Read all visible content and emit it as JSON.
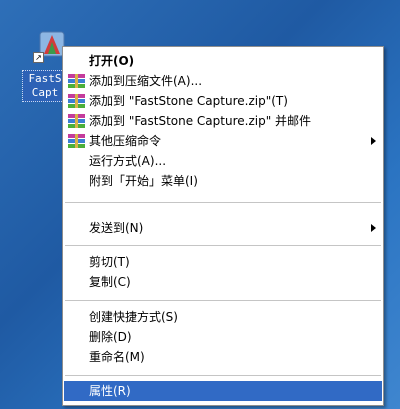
{
  "desktop": {
    "icon_label_line1": "FastS",
    "icon_label_line2": "Capt",
    "shortcut_glyph": "↗"
  },
  "context_menu": {
    "items": [
      {
        "label": "打开(O)",
        "bold": true,
        "icon": null,
        "submenu": false
      },
      {
        "label": "添加到压缩文件(A)...",
        "icon": "winrar-archive-icon",
        "submenu": false
      },
      {
        "label": "添加到 \"FastStone Capture.zip\"(T)",
        "icon": "winrar-archive-icon",
        "submenu": false
      },
      {
        "label": "添加到 \"FastStone Capture.zip\" 并邮件",
        "icon": "winrar-archive-icon",
        "submenu": false
      },
      {
        "label": "其他压缩命令",
        "icon": "winrar-archive-icon",
        "submenu": true
      },
      {
        "label": "运行方式(A)...",
        "icon": null,
        "submenu": false
      },
      {
        "label": "附到「开始」菜单(I)",
        "icon": null,
        "submenu": false
      },
      {
        "label": "发送到(N)",
        "icon": null,
        "submenu": true
      },
      {
        "label": "剪切(T)",
        "icon": null,
        "submenu": false
      },
      {
        "label": "复制(C)",
        "icon": null,
        "submenu": false
      },
      {
        "label": "创建快捷方式(S)",
        "icon": null,
        "submenu": false
      },
      {
        "label": "删除(D)",
        "icon": null,
        "submenu": false
      },
      {
        "label": "重命名(M)",
        "icon": null,
        "submenu": false
      },
      {
        "label": "属性(R)",
        "icon": null,
        "submenu": false,
        "selected": true
      }
    ]
  },
  "colors": {
    "selection": "#316ac5",
    "desktop": "#2e6fb8"
  }
}
